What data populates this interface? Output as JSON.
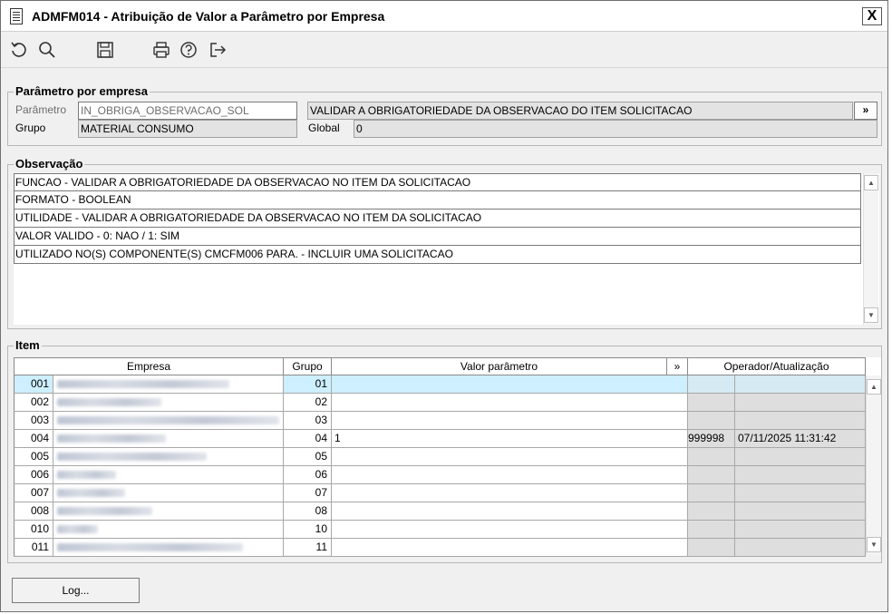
{
  "window": {
    "title": "ADMFM014 - Atribuição de Valor a Parâmetro por Empresa",
    "close_label": "X"
  },
  "toolbar": {
    "icons": [
      "undo-icon",
      "search-icon",
      "save-icon",
      "print-icon",
      "help-icon",
      "exit-icon"
    ]
  },
  "parametro_group": {
    "legend": "Parâmetro por empresa",
    "parametro_label": "Parâmetro",
    "parametro_value": "IN_OBRIGA_OBSERVACAO_SOL",
    "descricao_value": "VALIDAR A OBRIGATORIEDADE DA OBSERVACAO DO ITEM SOLICITACAO",
    "more_label": "»",
    "grupo_label": "Grupo",
    "grupo_value": "MATERIAL CONSUMO",
    "global_label": "Global",
    "global_value": "0"
  },
  "observacao": {
    "legend": "Observação",
    "lines": [
      "FUNCAO - VALIDAR A OBRIGATORIEDADE DA OBSERVACAO NO ITEM DA SOLICITACAO",
      "FORMATO - BOOLEAN",
      "UTILIDADE - VALIDAR A OBRIGATORIEDADE DA OBSERVACAO NO ITEM DA SOLICITACAO",
      "VALOR VALIDO - 0: NAO / 1: SIM",
      "UTILIZADO NO(S) COMPONENTE(S) CMCFM006 PARA. - INCLUIR UMA SOLICITACAO"
    ]
  },
  "item": {
    "legend": "Item",
    "headers": {
      "empresa": "Empresa",
      "grupo": "Grupo",
      "valor": "Valor parâmetro",
      "more": "»",
      "operador": "Operador/Atualização"
    },
    "rows": [
      {
        "code": "001",
        "grupo": "01",
        "valor": "",
        "operador": "",
        "data": ""
      },
      {
        "code": "002",
        "grupo": "02",
        "valor": "",
        "operador": "",
        "data": ""
      },
      {
        "code": "003",
        "grupo": "03",
        "valor": "",
        "operador": "",
        "data": ""
      },
      {
        "code": "004",
        "grupo": "04",
        "valor": "1",
        "operador": "999998",
        "data": "07/11/2025 11:31:42"
      },
      {
        "code": "005",
        "grupo": "05",
        "valor": "",
        "operador": "",
        "data": ""
      },
      {
        "code": "006",
        "grupo": "06",
        "valor": "",
        "operador": "",
        "data": ""
      },
      {
        "code": "007",
        "grupo": "07",
        "valor": "",
        "operador": "",
        "data": ""
      },
      {
        "code": "008",
        "grupo": "08",
        "valor": "",
        "operador": "",
        "data": ""
      },
      {
        "code": "010",
        "grupo": "10",
        "valor": "",
        "operador": "",
        "data": ""
      },
      {
        "code": "011",
        "grupo": "11",
        "valor": "",
        "operador": "",
        "data": ""
      }
    ]
  },
  "footer": {
    "log_label": "Log..."
  }
}
